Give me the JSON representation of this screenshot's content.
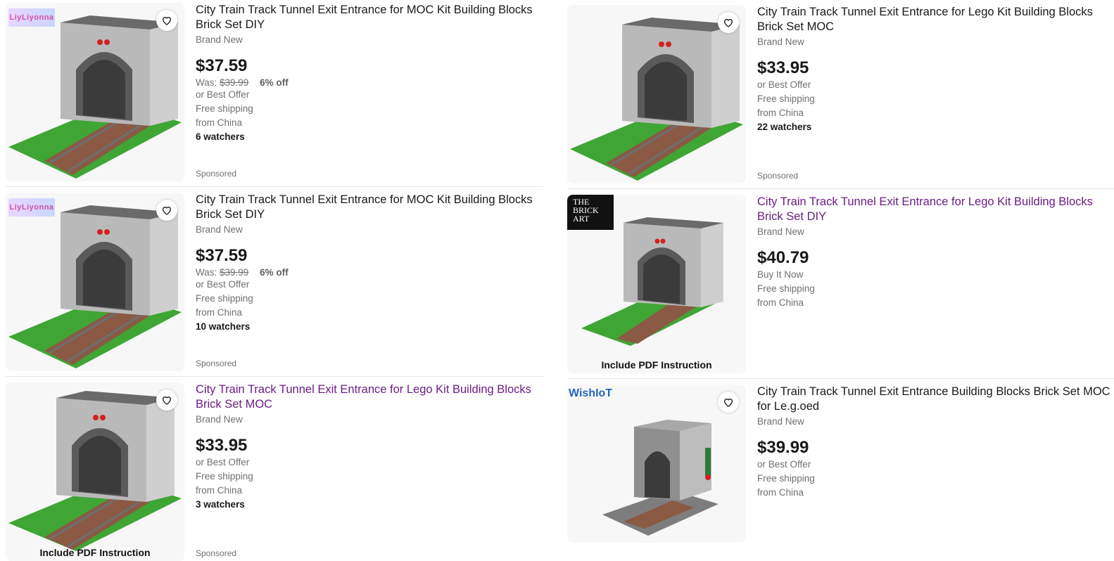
{
  "left_column": [
    {
      "title": "City Train Track Tunnel Exit Entrance for MOC Kit Building Blocks Brick Set DIY",
      "visited": false,
      "condition": "Brand New",
      "price": "$37.59",
      "was_label": "Was:",
      "was_price": "$39.99",
      "discount": "6% off",
      "purchase_option": "or Best Offer",
      "shipping": "Free shipping",
      "origin": "from China",
      "watchers": "6 watchers",
      "sponsored": "Sponsored",
      "seller_badge": "LiyLiyonna"
    },
    {
      "title": "City Train Track Tunnel Exit Entrance for MOC Kit Building Blocks Brick Set DIY",
      "visited": false,
      "condition": "Brand New",
      "price": "$37.59",
      "was_label": "Was:",
      "was_price": "$39.99",
      "discount": "6% off",
      "purchase_option": "or Best Offer",
      "shipping": "Free shipping",
      "origin": "from China",
      "watchers": "10 watchers",
      "sponsored": "Sponsored",
      "seller_badge": "LiyLiyonna"
    },
    {
      "title": "City Train Track Tunnel Exit Entrance for Lego Kit Building Blocks Brick Set MOC",
      "visited": true,
      "condition": "Brand New",
      "price": "$33.95",
      "purchase_option": "or Best Offer",
      "shipping": "Free shipping",
      "origin": "from China",
      "watchers": "3 watchers",
      "sponsored": "Sponsored",
      "image_caption": "Include PDF Instruction"
    }
  ],
  "right_column": [
    {
      "title": "City Train Track Tunnel Exit Entrance for Lego Kit Building Blocks Brick Set MOC",
      "visited": false,
      "condition": "Brand New",
      "price": "$33.95",
      "purchase_option": "or Best Offer",
      "shipping": "Free shipping",
      "origin": "from China",
      "watchers": "22 watchers",
      "sponsored": "Sponsored"
    },
    {
      "title": "City Train Track Tunnel Exit Entrance for Lego Kit Building Blocks Brick Set DIY",
      "visited": true,
      "condition": "Brand New",
      "price": "$40.79",
      "purchase_option": "Buy It Now",
      "shipping": "Free shipping",
      "origin": "from China",
      "image_caption": "Include PDF Instruction",
      "seller_badge": "THE BRICK ART"
    },
    {
      "title": "City Train Track Tunnel Exit Entrance Building Blocks Brick Set MOC for Le.g.oed",
      "visited": false,
      "condition": "Brand New",
      "price": "$39.99",
      "purchase_option": "or Best Offer",
      "shipping": "Free shipping",
      "origin": "from China",
      "seller_badge": "WishIoT"
    }
  ],
  "colors": {
    "visited_link": "#6c1d82",
    "text": "#191919",
    "secondary": "#707070",
    "grass": "#3fa535",
    "stone": "#9a9a9a",
    "rail_tie": "#7a3f2a"
  },
  "icons": {
    "watch": "heart-icon"
  }
}
